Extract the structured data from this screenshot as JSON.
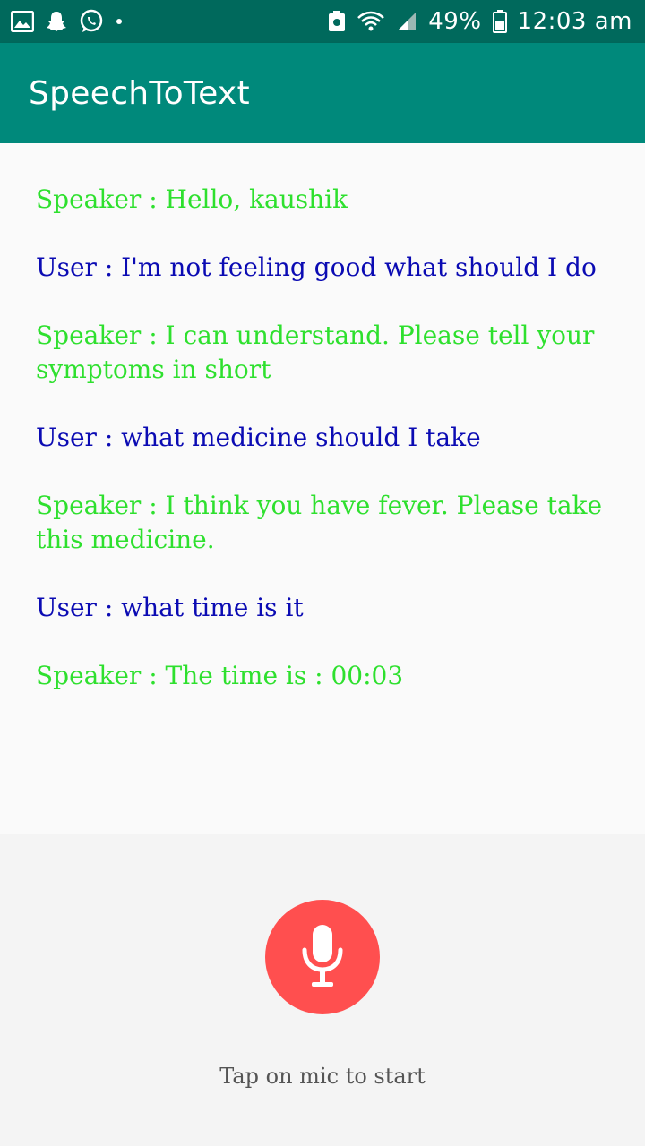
{
  "status_bar": {
    "battery_percent": "49%",
    "time": "12:03 am",
    "icons": [
      "gallery-icon",
      "snapchat-icon",
      "whatsapp-icon",
      "dot-icon",
      "save-icon",
      "wifi-icon",
      "signal-icon",
      "battery-icon"
    ]
  },
  "app_bar": {
    "title": "SpeechToText",
    "color": "#00897b"
  },
  "chat": {
    "messages": [
      {
        "role": "speaker",
        "text": "Speaker : Hello, kaushik"
      },
      {
        "role": "user",
        "text": "User : I'm not feeling good what should I do"
      },
      {
        "role": "speaker",
        "text": "Speaker : I can understand. Please tell your symptoms in short"
      },
      {
        "role": "user",
        "text": "User : what medicine should I take"
      },
      {
        "role": "speaker",
        "text": "Speaker : I think you have fever. Please take this medicine."
      },
      {
        "role": "user",
        "text": "User : what time is it"
      },
      {
        "role": "speaker",
        "text": "Speaker : The time is : 00:03"
      }
    ],
    "speaker_color": "#2ee02e",
    "user_color": "#0b0bb3"
  },
  "controls": {
    "mic_icon": "microphone-icon",
    "mic_color": "#ff4f4f",
    "hint": "Tap on mic to start"
  }
}
